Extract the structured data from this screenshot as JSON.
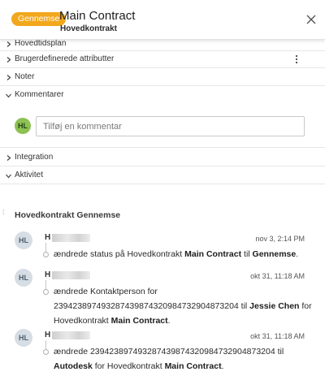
{
  "header": {
    "status": "Gennemse",
    "title": "Main Contract",
    "subtitle": "Hovedkontrakt"
  },
  "sections": {
    "schedule": "Hovedtidsplan",
    "custom_attributes": "Brugerdefinerede attributter",
    "notes": "Noter",
    "comments": "Kommentarer",
    "integration": "Integration",
    "activity": "Aktivitet"
  },
  "comment": {
    "avatar": "HL",
    "placeholder": "Tilføj en kommentar",
    "value": ""
  },
  "activity": {
    "heading": "Hovedkontrakt Gennemse",
    "entries": [
      {
        "avatar": "HL",
        "user_initial": "H",
        "time": "nov 3, 2:14 PM",
        "line1": {
          "t1": "ændrede status på Hovedkontrakt ",
          "b1": "Main Contract",
          "t2": " til ",
          "b2": "Gennemse",
          "t3": "."
        }
      },
      {
        "avatar": "HL",
        "user_initial": "H",
        "time": "okt 31, 11:18 AM",
        "line1": {
          "t1": "ændrede Kontaktperson for"
        },
        "line2": {
          "t1": "239423897493287439874320984732904873204",
          "t2": " til ",
          "b1": "Jessie Chen",
          "t3": " for"
        },
        "line3": {
          "t1": "Hovedkontrakt ",
          "b1": "Main Contract",
          "t2": "."
        }
      },
      {
        "avatar": "HL",
        "user_initial": "H",
        "time": "okt 31, 11:18 AM",
        "line1": {
          "t1": "ændrede 239423897493287439874320984732904873204",
          "t2": " til"
        },
        "line2": {
          "b1": "Autodesk",
          "t1": " for Hovedkontrakt ",
          "b2": "Main Contract",
          "t2": "."
        }
      }
    ]
  },
  "colors": {
    "status_pill": "#f2a71c",
    "current_user_avatar": "#8dc152",
    "activity_avatar": "#d6dde4"
  },
  "icons": {
    "close": "close-icon",
    "expand": "chevron-right-icon",
    "collapse": "chevron-down-icon",
    "more": "kebab-menu-icon"
  }
}
